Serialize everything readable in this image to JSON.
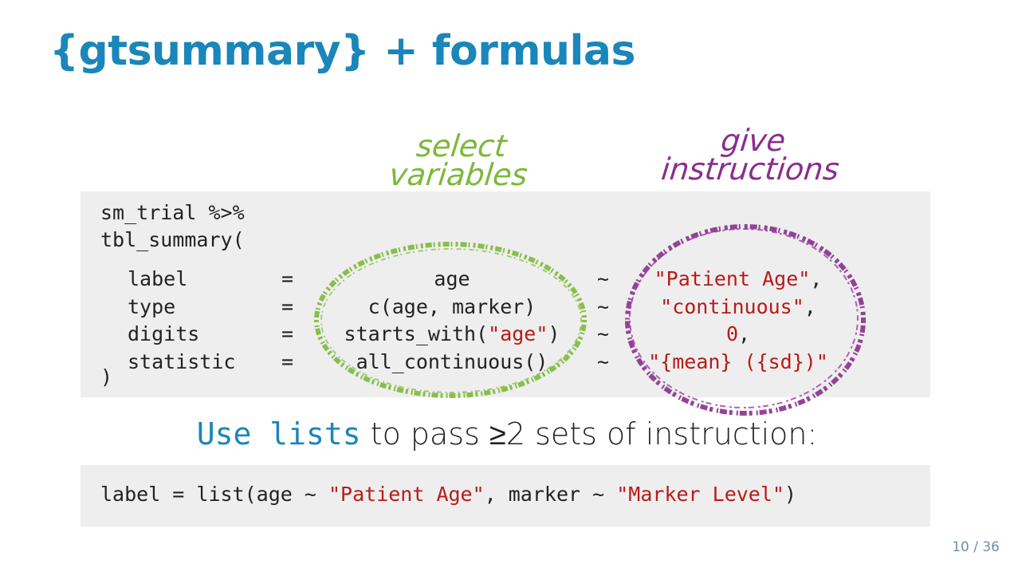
{
  "slide": {
    "title": "{gtsummary} + formulas",
    "page_number": "10 / 36"
  },
  "annotations": {
    "select_line1": "select",
    "select_line2": "variables",
    "give_line1": "give",
    "give_line2": "instructions"
  },
  "code1": {
    "line1": "sm_trial %>%",
    "line2": "tbl_summary(",
    "rows": [
      {
        "arg": "label",
        "eq": "=",
        "sel_pre": "age",
        "sel_str": "",
        "sel_post": "",
        "tilde": "~",
        "val_str": "\"Patient Age\"",
        "val_post": ","
      },
      {
        "arg": "type",
        "eq": "=",
        "sel_pre": "c(age, marker)",
        "sel_str": "",
        "sel_post": "",
        "tilde": "~",
        "val_str": "\"continuous\"",
        "val_post": ","
      },
      {
        "arg": "digits",
        "eq": "=",
        "sel_pre": "starts_with(",
        "sel_str": "\"age\"",
        "sel_post": ")",
        "tilde": "~",
        "val_str": "0",
        "val_post": ","
      },
      {
        "arg": "statistic",
        "eq": "=",
        "sel_pre": "all_continuous()",
        "sel_str": "",
        "sel_post": "",
        "tilde": "~",
        "val_str": "\"{mean} ({sd})\"",
        "val_post": ""
      }
    ],
    "close": ")"
  },
  "subtitle": {
    "code": "Use lists",
    "text": " to pass ≥2 sets of instruction:"
  },
  "code2": {
    "p1": "label = list(age ~ ",
    "s1": "\"Patient Age\"",
    "p2": ", marker ~ ",
    "s2": "\"Marker Level\"",
    "p3": ")"
  },
  "colors": {
    "title": "#1a86b9",
    "string": "#b81a1a",
    "select_annotation": "#7cb83a",
    "instruction_annotation": "#8a2d8e",
    "code_background": "#eeeeee"
  }
}
